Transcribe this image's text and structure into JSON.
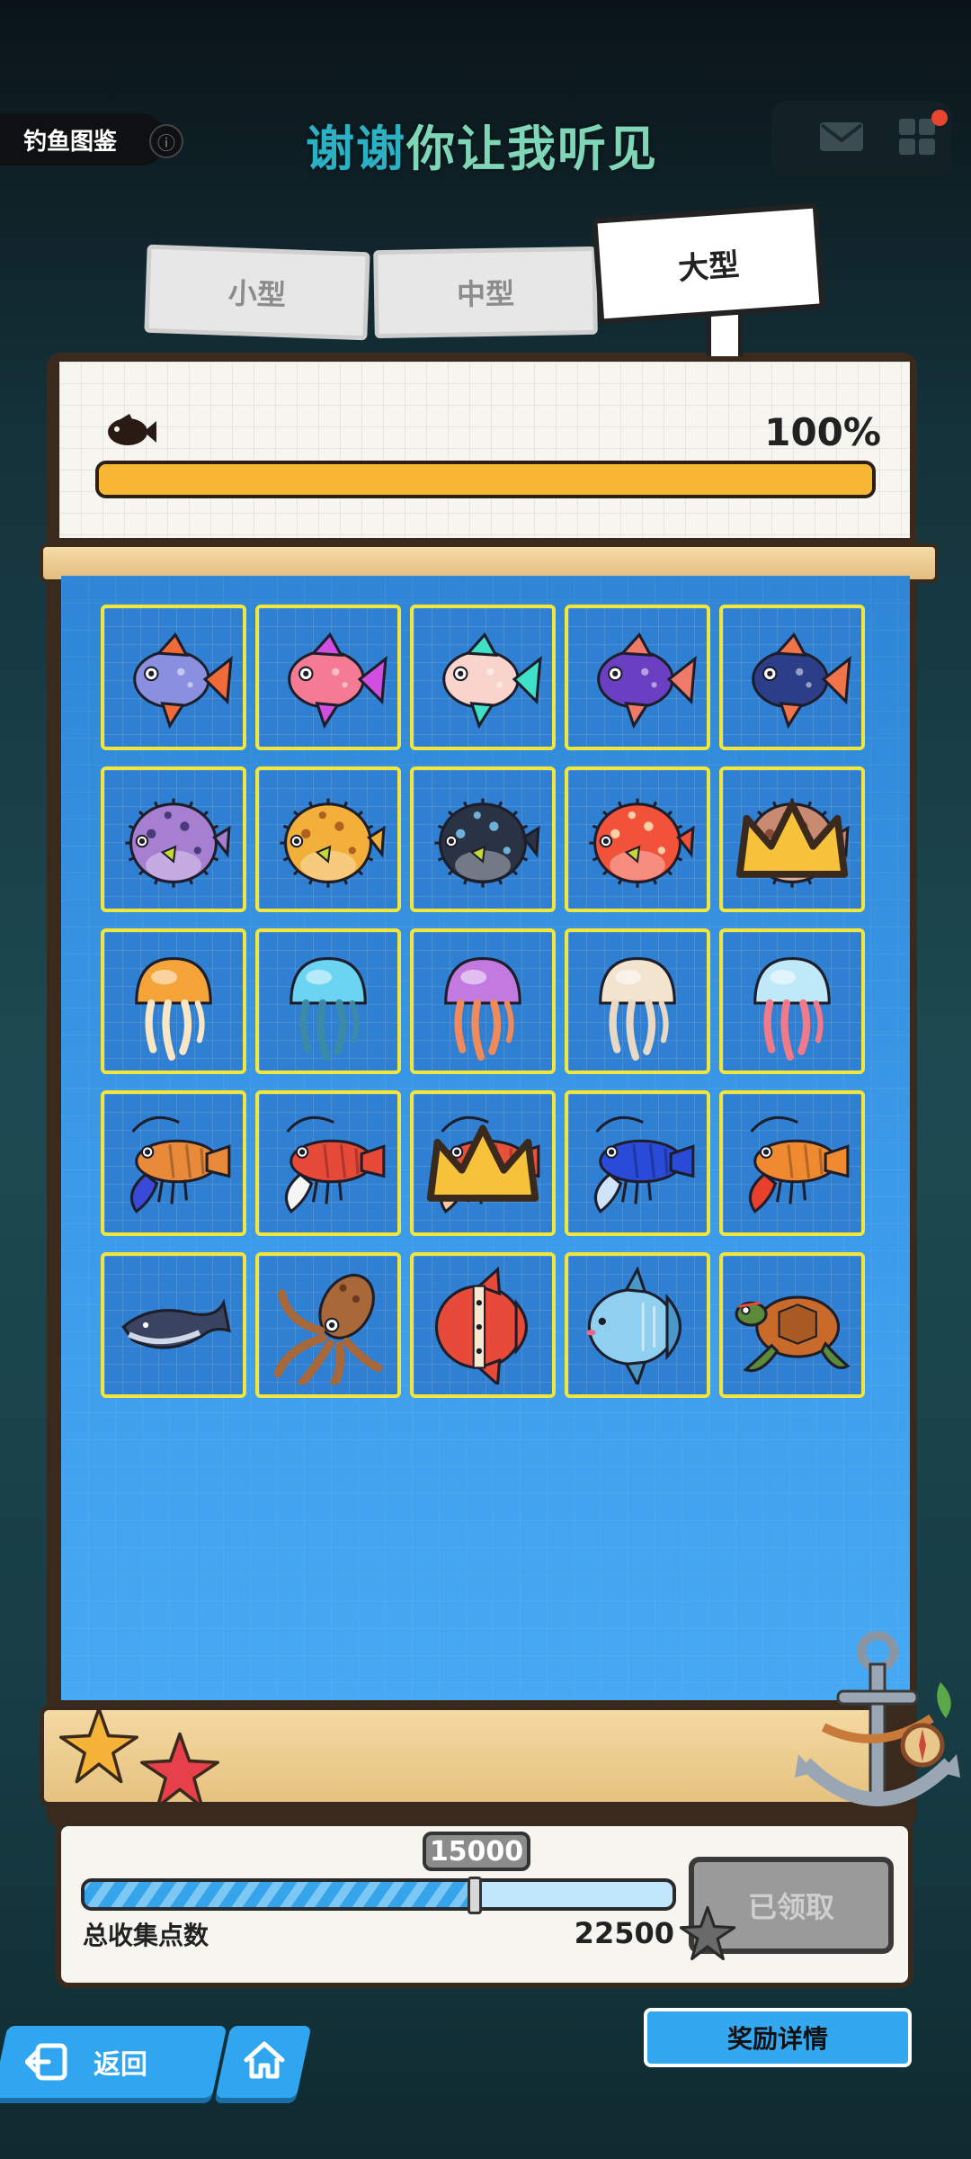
{
  "header": {
    "title": "钓鱼图鉴",
    "info_icon": "ⓘ",
    "banner_part1": "谢谢",
    "banner_part2": "你让我听见"
  },
  "tabs": [
    {
      "label": "小型",
      "selected": false
    },
    {
      "label": "中型",
      "selected": false
    },
    {
      "label": "大型",
      "selected": true
    }
  ],
  "progress": {
    "percent_text": "100%",
    "value": 1.0
  },
  "grid": {
    "rows": 5,
    "cols": 5,
    "items": [
      {
        "name": "orange-fin-fish-icon",
        "kind": "fish",
        "color": "#8a8fe0",
        "accent": "#f06a3a",
        "crown": false
      },
      {
        "name": "pink-fish-icon",
        "kind": "fish",
        "color": "#f57b95",
        "accent": "#d14fe0",
        "crown": false
      },
      {
        "name": "spotted-fancy-fish-icon",
        "kind": "fish",
        "color": "#f8d4cc",
        "accent": "#3fe0c8",
        "crown": false
      },
      {
        "name": "purple-fish-icon",
        "kind": "fish",
        "color": "#6a3fc2",
        "accent": "#f07a68",
        "crown": false
      },
      {
        "name": "dark-blue-fish-icon",
        "kind": "fish",
        "color": "#2c3e88",
        "accent": "#f0734a",
        "crown": false
      },
      {
        "name": "purple-puffer-icon",
        "kind": "puffer",
        "color": "#a77fd1",
        "accent": "#4a3a7a",
        "crown": false
      },
      {
        "name": "yellow-puffer-icon",
        "kind": "puffer",
        "color": "#f2b03a",
        "accent": "#b06020",
        "crown": false
      },
      {
        "name": "black-puffer-icon",
        "kind": "puffer",
        "color": "#2a3344",
        "accent": "#6fb0d8",
        "crown": false
      },
      {
        "name": "red-puffer-icon",
        "kind": "puffer",
        "color": "#f2513a",
        "accent": "#ffd0a8",
        "crown": false
      },
      {
        "name": "brown-puffer-icon",
        "kind": "puffer",
        "color": "#c88a70",
        "accent": "#8a4a3a",
        "crown": true
      },
      {
        "name": "orange-jellyfish-icon",
        "kind": "jelly",
        "color": "#f5a43a",
        "accent": "#f8e6c4",
        "crown": false
      },
      {
        "name": "blue-jellyfish-icon",
        "kind": "jelly",
        "color": "#6ad4f2",
        "accent": "#3a8aa8",
        "crown": false
      },
      {
        "name": "purple-jellyfish-icon",
        "kind": "jelly",
        "color": "#c27ae0",
        "accent": "#f08a5a",
        "crown": false
      },
      {
        "name": "cream-jellyfish-icon",
        "kind": "jelly",
        "color": "#f3e4d0",
        "accent": "#e8d8c4",
        "crown": false
      },
      {
        "name": "pink-jellyfish-icon",
        "kind": "jelly",
        "color": "#bfe8f8",
        "accent": "#f07a8a",
        "crown": false
      },
      {
        "name": "orange-lobster-icon",
        "kind": "lobster",
        "color": "#e88a3a",
        "accent": "#3a4ad8",
        "crown": false
      },
      {
        "name": "white-red-lobster-icon",
        "kind": "lobster",
        "color": "#e84a3a",
        "accent": "#f5f5f5",
        "crown": false
      },
      {
        "name": "red-lobster-icon",
        "kind": "lobster",
        "color": "#e8503a",
        "accent": "#f8c8a0",
        "crown": true
      },
      {
        "name": "blue-lobster-icon",
        "kind": "lobster",
        "color": "#2a4ad8",
        "accent": "#cfe4f8",
        "crown": false
      },
      {
        "name": "orange-crayfish-icon",
        "kind": "lobster",
        "color": "#f08a30",
        "accent": "#e8402a",
        "crown": false
      },
      {
        "name": "whale-icon",
        "kind": "whale",
        "color": "#3a4460",
        "accent": "#cfd8e8",
        "crown": false
      },
      {
        "name": "squid-icon",
        "kind": "squid",
        "color": "#a8683a",
        "accent": "#6a3a1e",
        "crown": false
      },
      {
        "name": "red-sunfish-icon",
        "kind": "sunfish",
        "color": "#e84a3a",
        "accent": "#f8e8d0",
        "crown": false
      },
      {
        "name": "blue-sunfish-icon",
        "kind": "molamola",
        "color": "#8fd0f0",
        "accent": "#4a98c8",
        "crown": false
      },
      {
        "name": "sea-turtle-icon",
        "kind": "turtle",
        "color": "#c86a2a",
        "accent": "#5a8a3a",
        "crown": false
      }
    ]
  },
  "reward": {
    "milestone": "15000",
    "label": "总收集点数",
    "total": "22500",
    "fill": 0.66,
    "claimed_label": "已领取"
  },
  "nav": {
    "back_label": "返回",
    "details_label": "奖励详情"
  },
  "colors": {
    "progress_bar": "#f8b733",
    "cell_border": "#f2e53b",
    "water": "#3b9ae8",
    "nav_button": "#2fa6ef"
  }
}
